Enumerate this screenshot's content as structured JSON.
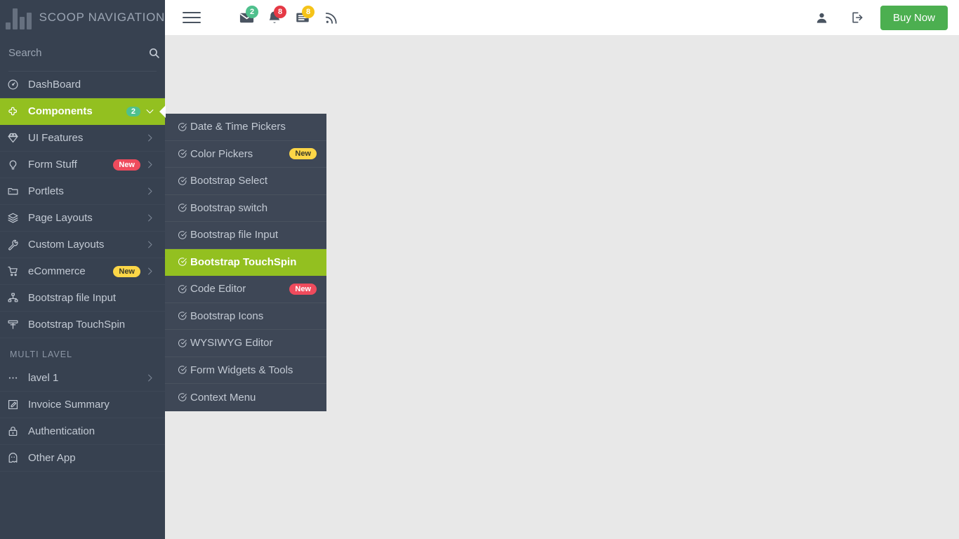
{
  "brand": {
    "title": "SCOOP NAVIGATION",
    "logo_icon": "bar-chart-logo-icon"
  },
  "search": {
    "placeholder": "Search",
    "value": "",
    "icon": "search-icon"
  },
  "header": {
    "menu_toggle_icon": "hamburger-icon",
    "icons": [
      {
        "name": "envelope-icon",
        "glyph": "✉",
        "badge": "2",
        "badge_color": "#4fc08d"
      },
      {
        "name": "bell-icon",
        "glyph": "🔔",
        "badge": "8",
        "badge_color": "#e53945"
      },
      {
        "name": "tasks-icon",
        "glyph": "☰",
        "badge": "8",
        "badge_color": "#f5c319"
      },
      {
        "name": "rss-icon",
        "glyph": "●",
        "badge": "",
        "badge_color": ""
      }
    ],
    "user_icon": "user-icon",
    "logout_icon": "logout-icon",
    "buy_now_label": "Buy Now",
    "buy_now_color": "#4caf50"
  },
  "sidebar": {
    "items": [
      {
        "label": "DashBoard",
        "icon": "speedometer-icon",
        "badge": "",
        "badge_type": "",
        "chevron": "",
        "active": false
      },
      {
        "label": "Components",
        "icon": "components-icon",
        "badge": "2",
        "badge_type": "count",
        "chevron": "down",
        "active": true
      },
      {
        "label": "UI Features",
        "icon": "diamond-icon",
        "badge": "",
        "badge_type": "",
        "chevron": "right",
        "active": false
      },
      {
        "label": "Form Stuff",
        "icon": "bulb-icon",
        "badge": "New",
        "badge_type": "red",
        "chevron": "right",
        "active": false
      },
      {
        "label": "Portlets",
        "icon": "folder-icon",
        "badge": "",
        "badge_type": "",
        "chevron": "right",
        "active": false
      },
      {
        "label": "Page Layouts",
        "icon": "layers-icon",
        "badge": "",
        "badge_type": "",
        "chevron": "right",
        "active": false
      },
      {
        "label": "Custom Layouts",
        "icon": "wrench-icon",
        "badge": "",
        "badge_type": "",
        "chevron": "right",
        "active": false
      },
      {
        "label": "eCommerce",
        "icon": "cart-icon",
        "badge": "New",
        "badge_type": "yellow",
        "chevron": "right",
        "active": false
      },
      {
        "label": "Bootstrap file Input",
        "icon": "sitemap-icon",
        "badge": "",
        "badge_type": "",
        "chevron": "",
        "active": false
      },
      {
        "label": "Bootstrap TouchSpin",
        "icon": "touchspin-icon",
        "badge": "",
        "badge_type": "",
        "chevron": "",
        "active": false
      }
    ],
    "section_label": "MULTI LAVEL",
    "multilevel_items": [
      {
        "label": "lavel 1",
        "icon": "ellipsis-icon",
        "badge": "",
        "badge_type": "",
        "chevron": "right",
        "active": false
      },
      {
        "label": "Invoice Summary",
        "icon": "edit-square-icon",
        "badge": "",
        "badge_type": "",
        "chevron": "",
        "active": false
      },
      {
        "label": "Authentication",
        "icon": "lock-icon",
        "badge": "",
        "badge_type": "",
        "chevron": "",
        "active": false
      },
      {
        "label": "Other App",
        "icon": "ghost-icon",
        "badge": "",
        "badge_type": "",
        "chevron": "",
        "active": false
      }
    ]
  },
  "submenu": {
    "items": [
      {
        "label": "Date & Time Pickers",
        "icon": "check-circle-icon",
        "badge": "",
        "badge_type": "",
        "active": false
      },
      {
        "label": "Color Pickers",
        "icon": "check-circle-icon",
        "badge": "New",
        "badge_type": "yellow",
        "active": false
      },
      {
        "label": "Bootstrap Select",
        "icon": "check-circle-icon",
        "badge": "",
        "badge_type": "",
        "active": false
      },
      {
        "label": "Bootstrap switch",
        "icon": "check-circle-icon",
        "badge": "",
        "badge_type": "",
        "active": false
      },
      {
        "label": "Bootstrap file Input",
        "icon": "check-circle-icon",
        "badge": "",
        "badge_type": "",
        "active": false
      },
      {
        "label": "Bootstrap TouchSpin",
        "icon": "check-circle-icon",
        "badge": "",
        "badge_type": "",
        "active": true
      },
      {
        "label": "Code Editor",
        "icon": "check-circle-icon",
        "badge": "New",
        "badge_type": "red",
        "active": false
      },
      {
        "label": "Bootstrap Icons",
        "icon": "check-circle-icon",
        "badge": "",
        "badge_type": "",
        "active": false
      },
      {
        "label": "WYSIWYG Editor",
        "icon": "check-circle-icon",
        "badge": "",
        "badge_type": "",
        "active": false
      },
      {
        "label": "Form Widgets & Tools",
        "icon": "check-circle-icon",
        "badge": "",
        "badge_type": "",
        "active": false
      },
      {
        "label": "Context Menu",
        "icon": "check-circle-icon",
        "badge": "",
        "badge_type": "",
        "active": false
      }
    ]
  },
  "theme": {
    "accent_green": "#93c020",
    "sidebar_bg": "#374150",
    "submenu_bg": "#3e4756",
    "content_bg": "#e8e8e8"
  }
}
